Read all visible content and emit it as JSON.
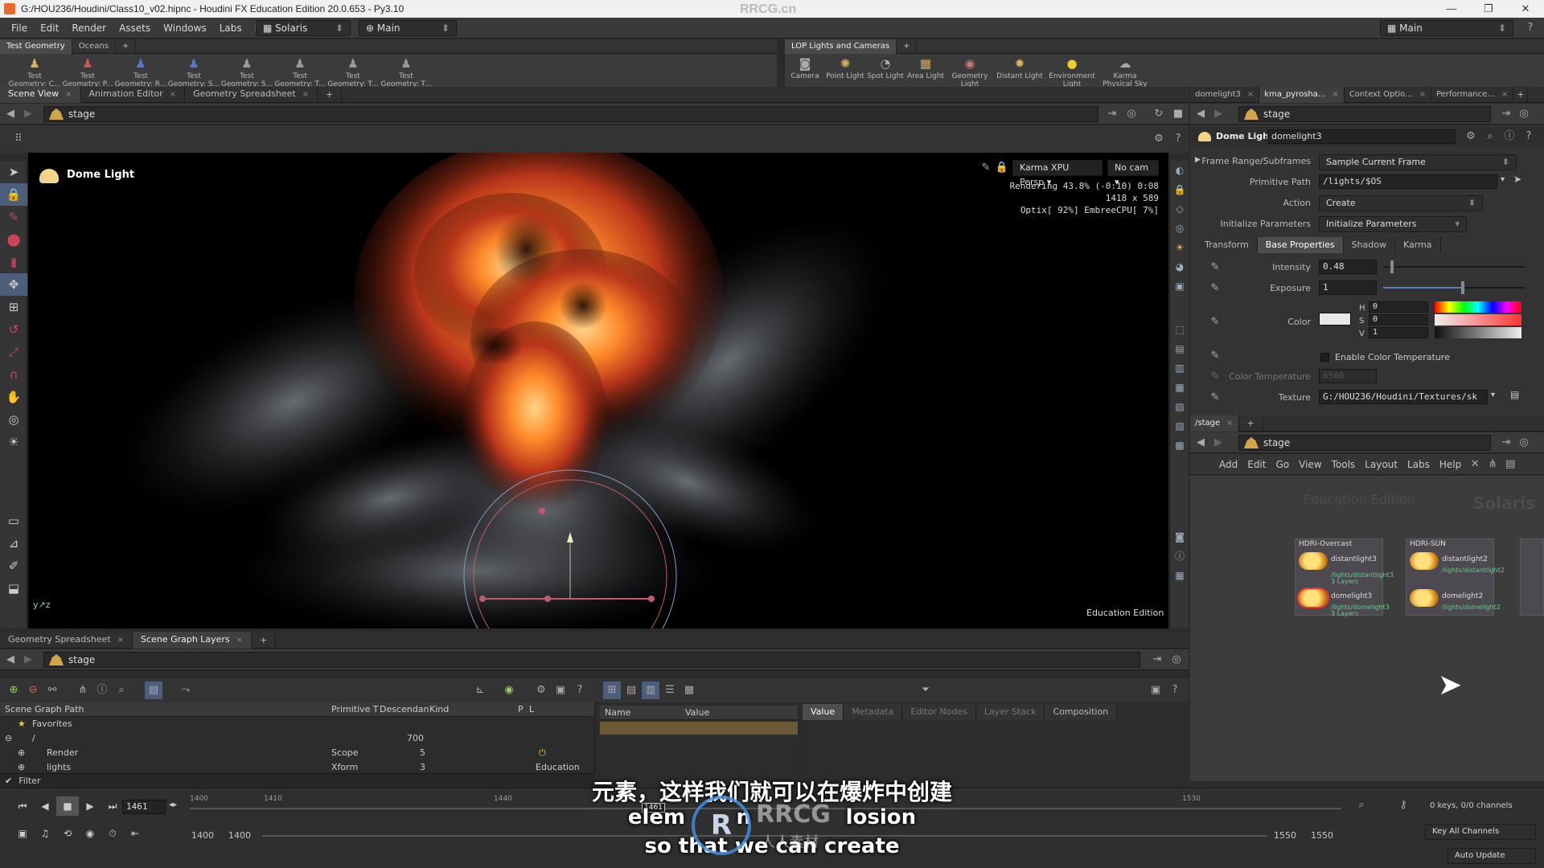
{
  "window": {
    "title": "G:/HOU236/Houdini/Class10_v02.hipnc - Houdini FX Education Edition 20.0.653 - Py3.10",
    "watermark": "RRCG.cn"
  },
  "menu": {
    "items": [
      "File",
      "Edit",
      "Render",
      "Assets",
      "Windows",
      "Labs",
      "Help"
    ],
    "desktop": "Solaris",
    "context": "Main",
    "right_desktop": "Main"
  },
  "shelf_left": {
    "tabs": [
      "Test Geometry",
      "Oceans"
    ],
    "tools": [
      {
        "line1": "Test",
        "line2": "Geometry: C..."
      },
      {
        "line1": "Test",
        "line2": "Geometry: P..."
      },
      {
        "line1": "Test",
        "line2": "Geometry: R..."
      },
      {
        "line1": "Test",
        "line2": "Geometry: S..."
      },
      {
        "line1": "Test",
        "line2": "Geometry: S..."
      },
      {
        "line1": "Test",
        "line2": "Geometry: T..."
      },
      {
        "line1": "Test",
        "line2": "Geometry: T..."
      },
      {
        "line1": "Test",
        "line2": "Geometry: T..."
      }
    ]
  },
  "shelf_right": {
    "tabs": [
      "LOP Lights and Cameras"
    ],
    "tools": [
      {
        "line1": "Camera",
        "line2": ""
      },
      {
        "line1": "Point Light",
        "line2": ""
      },
      {
        "line1": "Spot Light",
        "line2": ""
      },
      {
        "line1": "Area Light",
        "line2": ""
      },
      {
        "line1": "Geometry",
        "line2": "Light"
      },
      {
        "line1": "Distant Light",
        "line2": ""
      },
      {
        "line1": "Environment",
        "line2": "Light"
      },
      {
        "line1": "Karma",
        "line2": "Physical Sky"
      }
    ]
  },
  "scene_view": {
    "tabs": [
      "Scene View",
      "Animation Editor",
      "Geometry Spreadsheet"
    ],
    "path": "stage",
    "overlay_title": "Dome Light",
    "renderer": "Karma XPU Persp",
    "camera": "No cam",
    "stats_line1": "Rendering  43.8%  (-0:10)  0:08",
    "stats_line2": "1418 x 589",
    "stats_line3": "Optix[ 92%] EmbreeCPU[  7%]",
    "edition": "Education Edition"
  },
  "params": {
    "tabs": [
      "domelight3",
      "kma_pyrosha...",
      "Context Optio...",
      "Performance..."
    ],
    "path": "stage",
    "node_type": "Dome Light",
    "node_name": "domelight3",
    "frame_range_label": "Frame Range/Subframes",
    "frame_range_value": "Sample Current Frame",
    "primitive_path_label": "Primitive Path",
    "primitive_path_value": "/lights/$OS",
    "action_label": "Action",
    "action_value": "Create",
    "init_label": "Initialize Parameters",
    "init_value": "Initialize Parameters",
    "section_tabs": [
      "Transform",
      "Base Properties",
      "Shadow",
      "Karma"
    ],
    "intensity_label": "Intensity",
    "intensity_value": "0.48",
    "intensity_fraction": 0.05,
    "exposure_label": "Exposure",
    "exposure_value": "1",
    "exposure_fraction": 0.55,
    "color_label": "Color",
    "h_label": "H",
    "h_value": "0",
    "s_label": "S",
    "s_value": "0",
    "v_label": "V",
    "v_value": "1",
    "enable_temp_label": "Enable Color Temperature",
    "color_temp_label": "Color Temperature",
    "color_temp_value": "6500",
    "texture_label": "Texture",
    "texture_value": "G:/HOU236/Houdini/Textures/sk"
  },
  "network": {
    "tabs": [
      "/stage"
    ],
    "path": "stage",
    "menu": [
      "Add",
      "Edit",
      "Go",
      "View",
      "Tools",
      "Layout",
      "Labs",
      "Help"
    ],
    "watermark_edu": "Education Edition",
    "watermark_context": "Solaris",
    "boxes": [
      {
        "title": "HDRI-Overcast",
        "nodes": [
          {
            "name": "distantlight3",
            "sub": "/lights/distantlight3",
            "extra": "3 Layers"
          },
          {
            "name": "domelight3",
            "sub": "/lights/domelight3",
            "extra": "3 Layers"
          }
        ]
      },
      {
        "title": "HDRI-SUN",
        "nodes": [
          {
            "name": "distantlight2",
            "sub": "/lights/distantlight2",
            "extra": ""
          },
          {
            "name": "domelight2",
            "sub": "/lights/domelight2",
            "extra": ""
          }
        ]
      }
    ]
  },
  "scene_graph": {
    "tabs": [
      "Geometry Spreadsheet",
      "Scene Graph Layers"
    ],
    "path": "stage",
    "columns": [
      "Scene Graph Path",
      "Primitive T",
      "Descendan",
      "Kind",
      "P",
      "L"
    ],
    "rows": [
      {
        "name": "Favorites",
        "type": "",
        "desc": "",
        "kind": ""
      },
      {
        "name": "/",
        "type": "",
        "desc": "700",
        "kind": ""
      },
      {
        "name": "Render",
        "type": "Scope",
        "desc": "5",
        "kind": ""
      },
      {
        "name": "lights",
        "type": "Xform",
        "desc": "3",
        "kind": "Education"
      }
    ],
    "filter_label": "Filter",
    "props_columns": [
      "Name",
      "Value"
    ],
    "detail_tabs": [
      "Value",
      "Metadata",
      "Editor Nodes",
      "Layer Stack",
      "Composition"
    ]
  },
  "timeline": {
    "frame": "1461",
    "ticks": [
      "1400",
      "1410",
      "1440",
      "1530"
    ],
    "cursor": "1461",
    "start1": "1400",
    "start2": "1400",
    "end1": "1550",
    "end2": "1550",
    "keys": "0 keys, 0/0 channels",
    "key_all": "Key All Channels",
    "auto_update": "Auto Update"
  },
  "subtitles": {
    "cn": "元素，这样我们就可以在爆炸中创建",
    "en1": "elem       n             losion",
    "en2": "so that we can create",
    "logo_cn": "人人素材",
    "logo_en": "RRCG"
  }
}
